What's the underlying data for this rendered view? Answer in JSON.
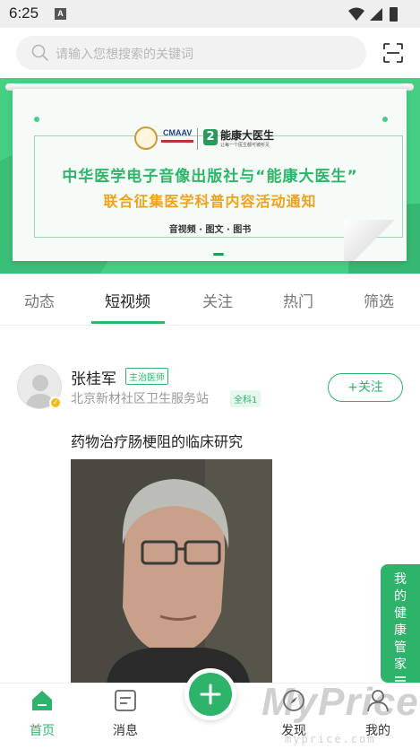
{
  "status_bar": {
    "time": "6:25",
    "notif_letter": "A"
  },
  "search": {
    "placeholder": "请输入您想搜索的关键词"
  },
  "banner": {
    "title_line1": "中华医学电子音像出版社与“能康大医生”",
    "title_line2": "联合征集医学科普内容活动通知",
    "subtitle": "音视频 · 图文 · 图书",
    "logo_cma": "CMAAV",
    "logo_brand": "能康大医生",
    "logo_n": "2",
    "logo_brand_sub": "让每一个医生都可被听见"
  },
  "tabs": [
    {
      "label": "动态",
      "active": false
    },
    {
      "label": "短视频",
      "active": true
    },
    {
      "label": "关注",
      "active": false
    },
    {
      "label": "热门",
      "active": false
    },
    {
      "label": "筛选",
      "active": false
    }
  ],
  "post": {
    "author_name": "张桂军",
    "author_title": "主治医师",
    "author_org": "北京新材社区卫生服务站",
    "author_level": "全科1",
    "follow_label": "+关注",
    "title": "药物治疗肠梗阻的临床研究"
  },
  "side_tab": {
    "label": "我的健康管家"
  },
  "bottom_nav": [
    {
      "label": "首页",
      "icon": "home-icon",
      "active": true
    },
    {
      "label": "消息",
      "icon": "message-icon",
      "active": false
    },
    {
      "label": "发现",
      "icon": "compass-icon",
      "active": false
    },
    {
      "label": "我的",
      "icon": "user-icon",
      "active": false
    }
  ],
  "watermark": {
    "text": "MyPrice",
    "sub": "myprice.com"
  },
  "colors": {
    "accent": "#2eb36b",
    "banner_green": "#45cf85",
    "banner_orange": "#f0a11c"
  }
}
